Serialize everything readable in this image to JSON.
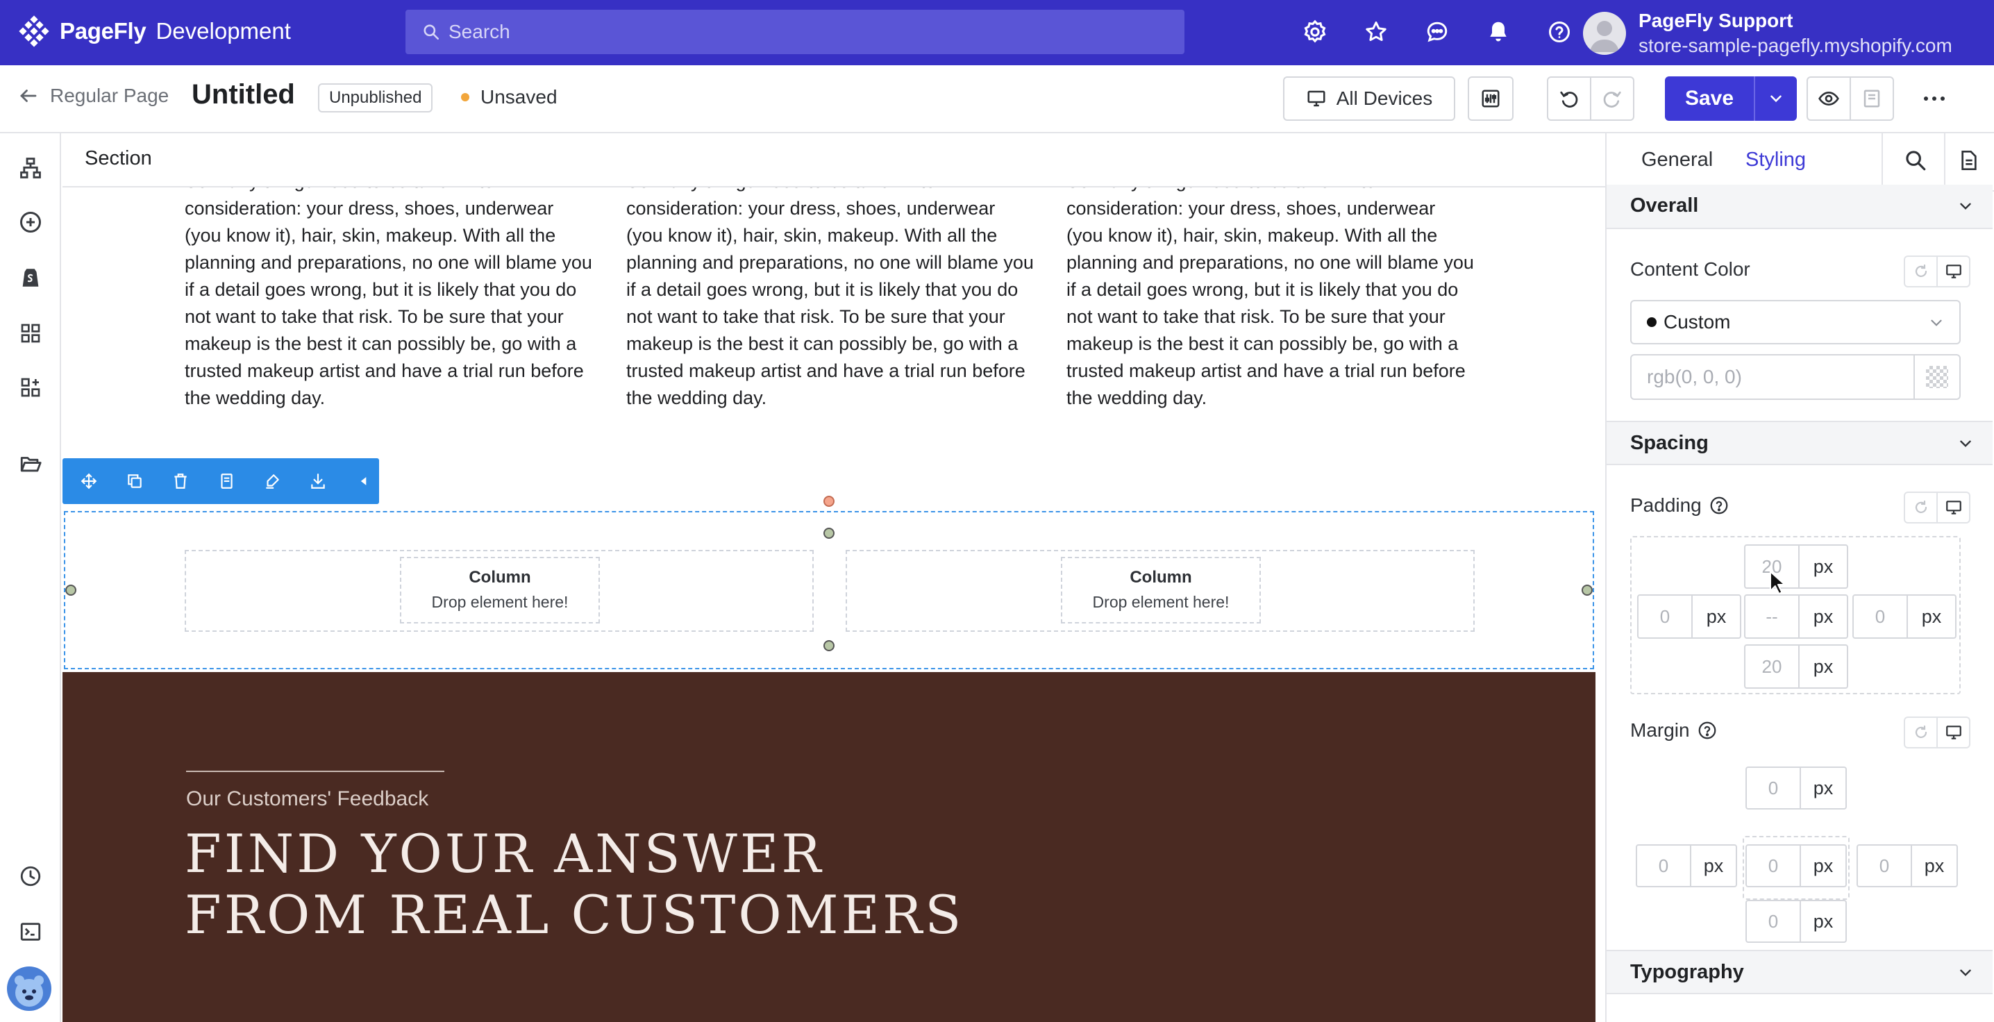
{
  "topbar": {
    "brand_name": "PageFly",
    "brand_sub": "Development",
    "search_placeholder": "Search",
    "account_name": "PageFly Support",
    "account_store": "store-sample-pagefly.myshopify.com",
    "colors": {
      "background": "#3730c4",
      "search": "#5a55d6"
    }
  },
  "toolbar": {
    "back_label": "Regular Page",
    "page_title": "Untitled",
    "status_badge": "Unpublished",
    "unsaved_label": "Unsaved",
    "devices_label": "All Devices",
    "save_label": "Save"
  },
  "canvas": {
    "section_label": "Section",
    "body_text": "So many things need to be taken into consideration: your dress, shoes, underwear (you know it), hair, skin, makeup. With all the planning and preparations, no one will blame you if a detail goes wrong, but it is likely that you do not want to take that risk. To be sure that your makeup is the best it can possibly be, go with a trusted makeup artist and have a trial run before the wedding day.",
    "columns": [
      {
        "title": "Column",
        "hint": "Drop element here!"
      },
      {
        "title": "Column",
        "hint": "Drop element here!"
      }
    ],
    "feedback_kicker": "Our Customers' Feedback",
    "feedback_line1": "FIND YOUR ANSWER",
    "feedback_line2": "FROM REAL CUSTOMERS",
    "colors": {
      "brown_section": "#4a2a22",
      "selection": "#3a93e8"
    }
  },
  "panel": {
    "tabs": [
      {
        "label": "General"
      },
      {
        "label": "Styling"
      }
    ],
    "overall_title": "Overall",
    "content_color_label": "Content Color",
    "select_value": "Custom",
    "color_placeholder": "rgb(0, 0, 0)",
    "spacing_title": "Spacing",
    "padding_label": "Padding",
    "padding": {
      "top": "20",
      "left": "0",
      "center": "--",
      "right": "0",
      "bottom": "20",
      "unit": "px"
    },
    "margin_label": "Margin",
    "margin": {
      "top": "0",
      "left": "0",
      "center": "0",
      "right": "0",
      "bottom": "0",
      "unit": "px"
    },
    "typography_title": "Typography",
    "accent": "#3d39d6"
  }
}
